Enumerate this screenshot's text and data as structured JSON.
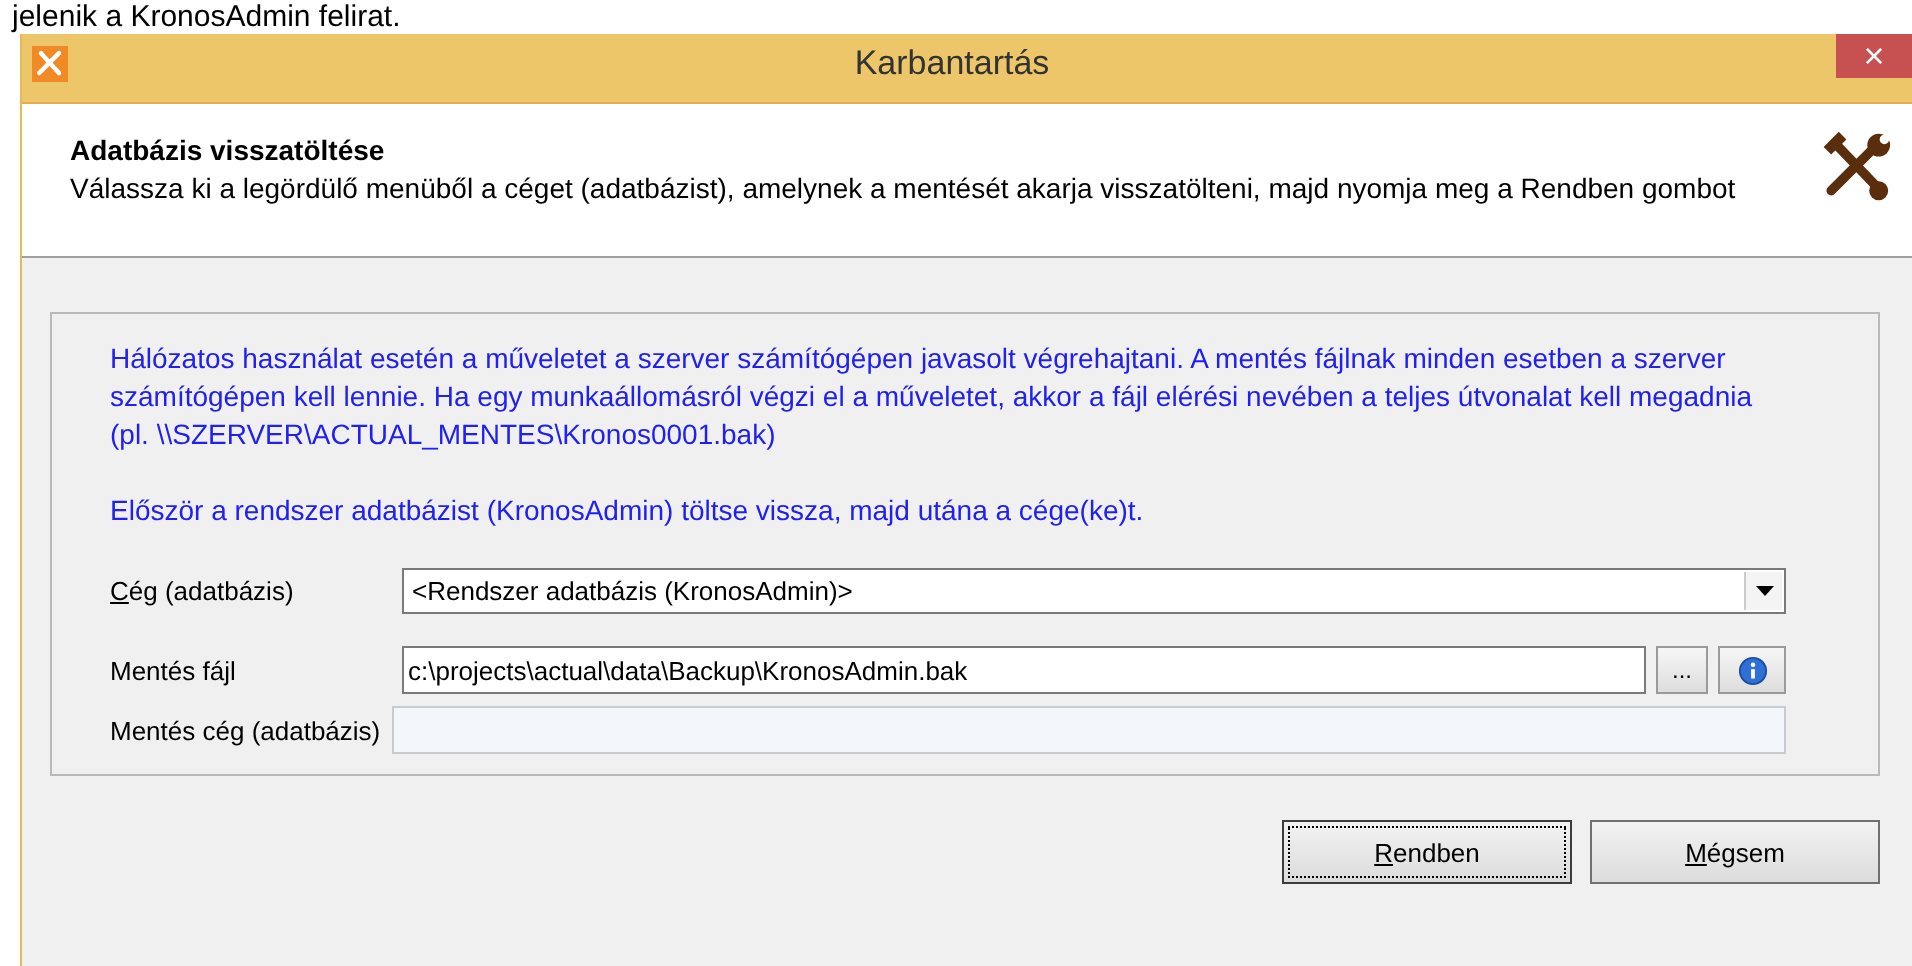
{
  "caption_above": "jelenik a KronosAdmin felirat.",
  "window": {
    "title": "Karbantartás",
    "close": "×"
  },
  "header": {
    "title": "Adatbázis visszatöltése",
    "description": "Válassza ki a legördülő menüből a céget (adatbázist), amelynek a mentését akarja visszatölteni, majd nyomja meg a Rendben gombot"
  },
  "notes": [
    "Hálózatos használat esetén a műveletet a szerver számítógépen javasolt végrehajtani. A mentés fájlnak minden esetben a szerver számítógépen kell lennie. Ha egy munkaállomásról végzi el a műveletet, akkor a fájl elérési nevében a teljes útvonalat kell megadnia (pl. \\\\SZERVER\\ACTUAL_MENTES\\Kronos0001.bak)",
    "Először a rendszer adatbázist (KronosAdmin) töltse vissza, majd utána a cége(ke)t."
  ],
  "fields": [
    {
      "kind": "dropdown",
      "label": "Cég (adatbázis)",
      "access_key": true,
      "value": "<Rendszer adatbázis (KronosAdmin)>",
      "disabled": false
    },
    {
      "kind": "file",
      "label": "Mentés fájl",
      "access_key": false,
      "value": "c:\\projects\\actual\\data\\Backup\\KronosAdmin.bak",
      "browse": "...",
      "disabled": false
    },
    {
      "kind": "text",
      "label": "Mentés cég (adatbázis)",
      "access_key": false,
      "disabled": true
    }
  ],
  "buttons": [
    {
      "label": "Rendben",
      "access_key": true,
      "focused": true
    },
    {
      "label": "Mégsem",
      "access_key": true,
      "focused": false
    }
  ]
}
